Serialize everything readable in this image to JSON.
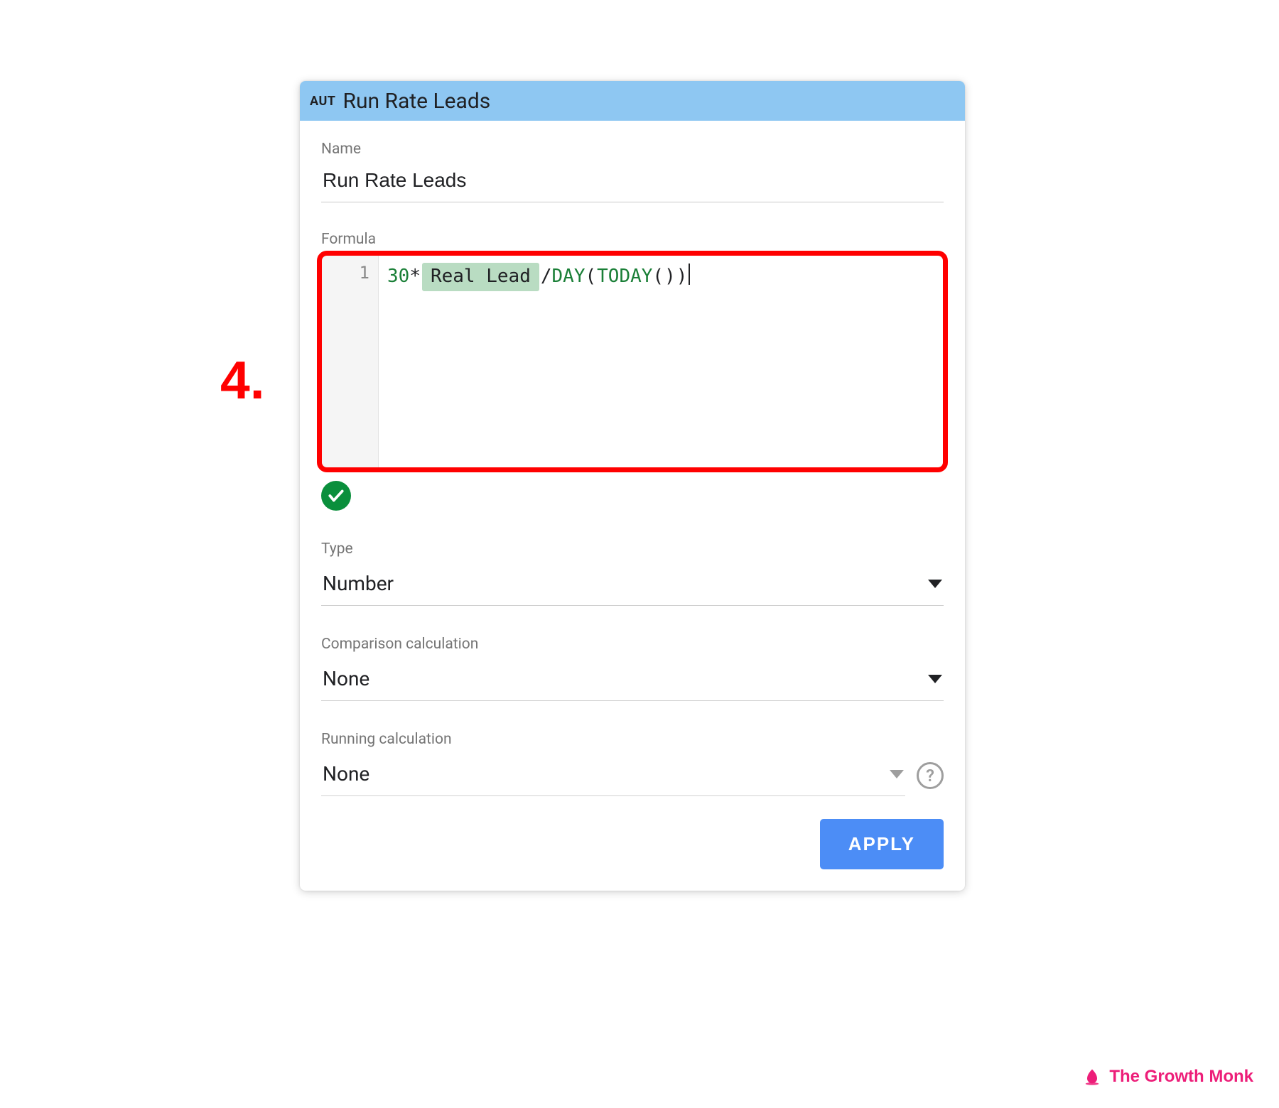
{
  "annotation": {
    "step": "4."
  },
  "panel": {
    "tag": "AUT",
    "title": "Run Rate Leads",
    "name": {
      "label": "Name",
      "value": "Run Rate Leads"
    },
    "formula": {
      "label": "Formula",
      "line_number": "1",
      "tokens": {
        "prefix_number": "30",
        "op1": "*",
        "chip": "Real Lead",
        "op2": "/",
        "fn1": "DAY",
        "fn2": "TODAY"
      }
    },
    "type": {
      "label": "Type",
      "value": "Number"
    },
    "comparison": {
      "label": "Comparison calculation",
      "value": "None"
    },
    "running": {
      "label": "Running calculation",
      "value": "None",
      "help": "?"
    },
    "apply": "APPLY"
  },
  "brand": "The Growth Monk"
}
